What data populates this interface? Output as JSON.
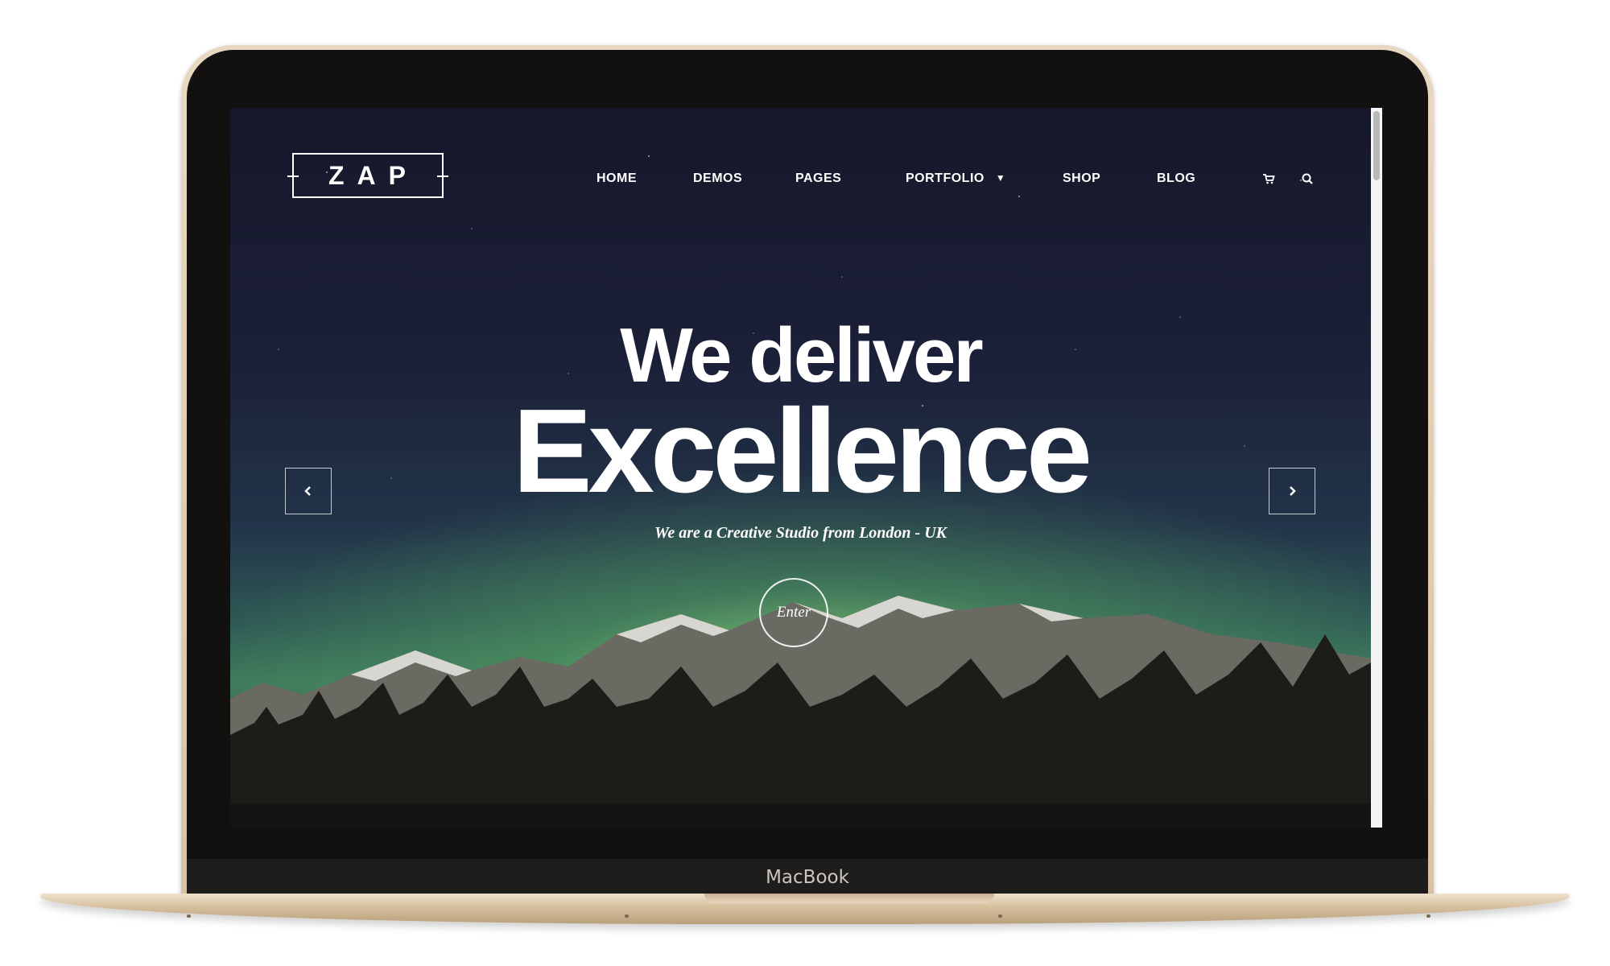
{
  "site": {
    "logo_text": "ZAP"
  },
  "nav": {
    "items": [
      {
        "label": "HOME"
      },
      {
        "label": "DEMOS"
      },
      {
        "label": "PAGES"
      },
      {
        "label": "PORTFOLIO"
      },
      {
        "label": "SHOP"
      },
      {
        "label": "BLOG"
      }
    ],
    "icons": [
      "cart-icon",
      "search-icon"
    ]
  },
  "hero": {
    "line1": "We deliver",
    "line2": "Excellence",
    "tagline": "We are a Creative Studio from London - UK",
    "enter_label": "Enter",
    "prev_icon": "chevron-left-icon",
    "next_icon": "chevron-right-icon"
  },
  "device": {
    "brand_label": "MacBook"
  },
  "colors": {
    "text": "#ffffff",
    "sky_top": "#16172a",
    "aurora": "#7fcf7a",
    "device_gold": "#e2ccad",
    "bezel": "#121110"
  }
}
